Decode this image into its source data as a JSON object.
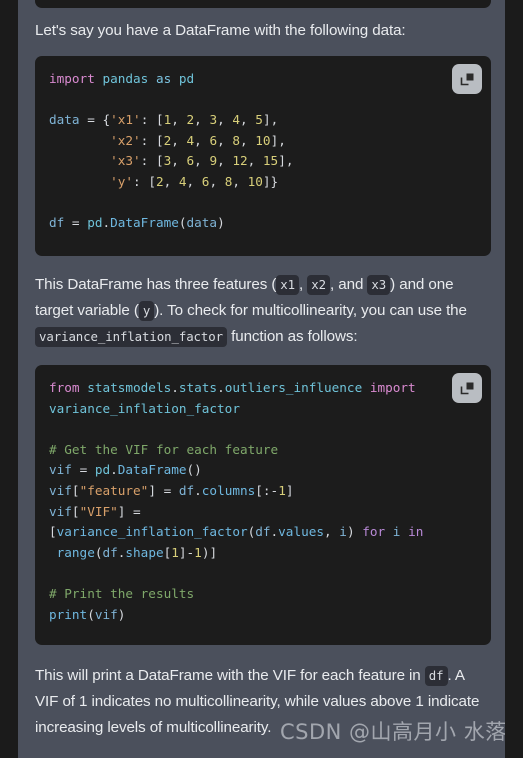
{
  "theme": {
    "page_gutter_color": "#1b1b1b",
    "chat_background": "#4b505c",
    "code_background": "#1c1c1c",
    "body_text_color": "#e9ebee",
    "inline_chip_background": "#2c2e36",
    "copy_button_color": "#b9bdc2"
  },
  "intro_paragraph": "Let's say you have a DataFrame with the following data:",
  "code_block_1": {
    "copy_button_label": "copy-code",
    "language": "python",
    "lines": [
      "import pandas as pd",
      "",
      "data = {'x1': [1, 2, 3, 4, 5],",
      "        'x2': [2, 4, 6, 8, 10],",
      "        'x3': [3, 6, 9, 12, 15],",
      "        'y': [2, 4, 6, 8, 10]}",
      "",
      "df = pd.DataFrame(data)"
    ]
  },
  "middle_paragraph": {
    "seg1": "This DataFrame has three features (",
    "chip_x1": "x1",
    "seg2": ", ",
    "chip_x2": "x2",
    "seg3": ", and ",
    "chip_x3": "x3",
    "seg4": ") and one target variable (",
    "chip_y": "y",
    "seg5": "). To check for multicollinearity, you can use the ",
    "chip_vif": "variance_inflation_factor",
    "seg6": " function as follows:"
  },
  "code_block_2": {
    "copy_button_label": "copy-code",
    "language": "python",
    "lines": [
      "from statsmodels.stats.outliers_influence import",
      "variance_inflation_factor",
      "",
      "# Get the VIF for each feature",
      "vif = pd.DataFrame()",
      "vif[\"feature\"] = df.columns[:-1]",
      "vif[\"VIF\"] =",
      "[variance_inflation_factor(df.values, i) for i in",
      " range(df.shape[1]-1)]",
      "",
      "# Print the results",
      "print(vif)"
    ]
  },
  "final_paragraph": {
    "seg1": "This will print a DataFrame with the VIF for each feature in ",
    "chip_df": "df",
    "seg2": ". A VIF of 1 indicates no multicollinearity, while values above 1 indicate increasing levels of multicollinearity."
  },
  "watermark": "CSDN @山高月小 水落石出"
}
